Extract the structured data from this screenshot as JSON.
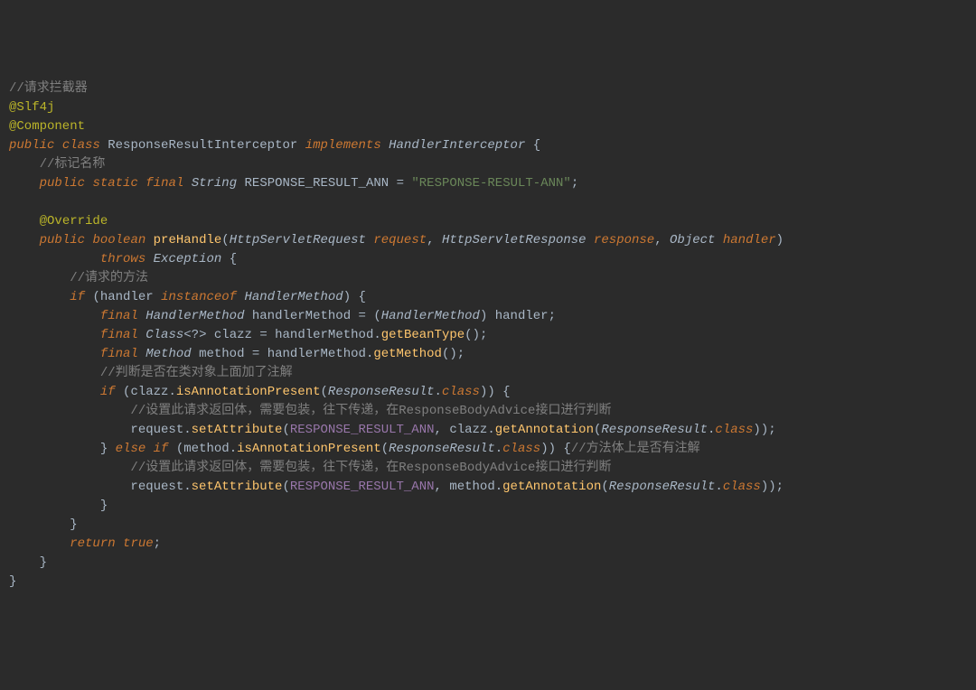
{
  "code": {
    "line1": "//请求拦截器",
    "line2_ann": "@Slf4j",
    "line3_ann": "@Component",
    "line4_public": "public",
    "line4_class": "class",
    "line4_name": "ResponseResultInterceptor",
    "line4_implements": "implements",
    "line4_iface": "HandlerInterceptor",
    "line5_comment": "//标记名称",
    "line6_public": "public",
    "line6_static": "static",
    "line6_final": "final",
    "line6_type": "String",
    "line6_var": "RESPONSE_RESULT_ANN",
    "line6_eq": "=",
    "line6_str": "\"RESPONSE-RESULT-ANN\"",
    "line8_ann": "@Override",
    "line9_public": "public",
    "line9_boolean": "boolean",
    "line9_method": "preHandle",
    "line9_t1": "HttpServletRequest",
    "line9_p1": "request",
    "line9_t2": "HttpServletResponse",
    "line9_p2": "response",
    "line9_t3": "Object",
    "line9_p3": "handler",
    "line10_throws": "throws",
    "line10_exc": "Exception",
    "line11_comment": "//请求的方法",
    "line12_if": "if",
    "line12_var": "handler",
    "line12_instanceof": "instanceof",
    "line12_type": "HandlerMethod",
    "line13_final": "final",
    "line13_type": "HandlerMethod",
    "line13_var": "handlerMethod",
    "line13_eq": "=",
    "line13_cast": "HandlerMethod",
    "line13_src": "handler",
    "line14_final": "final",
    "line14_type": "Class",
    "line14_wild": "<?>",
    "line14_var": "clazz",
    "line14_eq": "=",
    "line14_obj": "handlerMethod",
    "line14_call": "getBeanType",
    "line15_final": "final",
    "line15_type": "Method",
    "line15_var": "method",
    "line15_eq": "=",
    "line15_obj": "handlerMethod",
    "line15_call": "getMethod",
    "line16_comment": "//判断是否在类对象上面加了注解",
    "line17_if": "if",
    "line17_obj": "clazz",
    "line17_call": "isAnnotationPresent",
    "line17_arg": "ResponseResult",
    "line17_class": "class",
    "line18_comment": "//设置此请求返回体，需要包装，往下传递，在ResponseBodyAdvice接口进行判断",
    "line19_obj": "request",
    "line19_call": "setAttribute",
    "line19_arg1": "RESPONSE_RESULT_ANN",
    "line19_arg2obj": "clazz",
    "line19_arg2call": "getAnnotation",
    "line19_arg2arg": "ResponseResult",
    "line19_class": "class",
    "line20_else": "else",
    "line20_if": "if",
    "line20_obj": "method",
    "line20_call": "isAnnotationPresent",
    "line20_arg": "ResponseResult",
    "line20_class": "class",
    "line20_comment": "//方法体上是否有注解",
    "line21_comment": "//设置此请求返回体，需要包装，往下传递，在ResponseBodyAdvice接口进行判断",
    "line22_obj": "request",
    "line22_call": "setAttribute",
    "line22_arg1": "RESPONSE_RESULT_ANN",
    "line22_arg2obj": "method",
    "line22_arg2call": "getAnnotation",
    "line22_arg2arg": "ResponseResult",
    "line22_class": "class",
    "line25_return": "return",
    "line25_true": "true"
  }
}
